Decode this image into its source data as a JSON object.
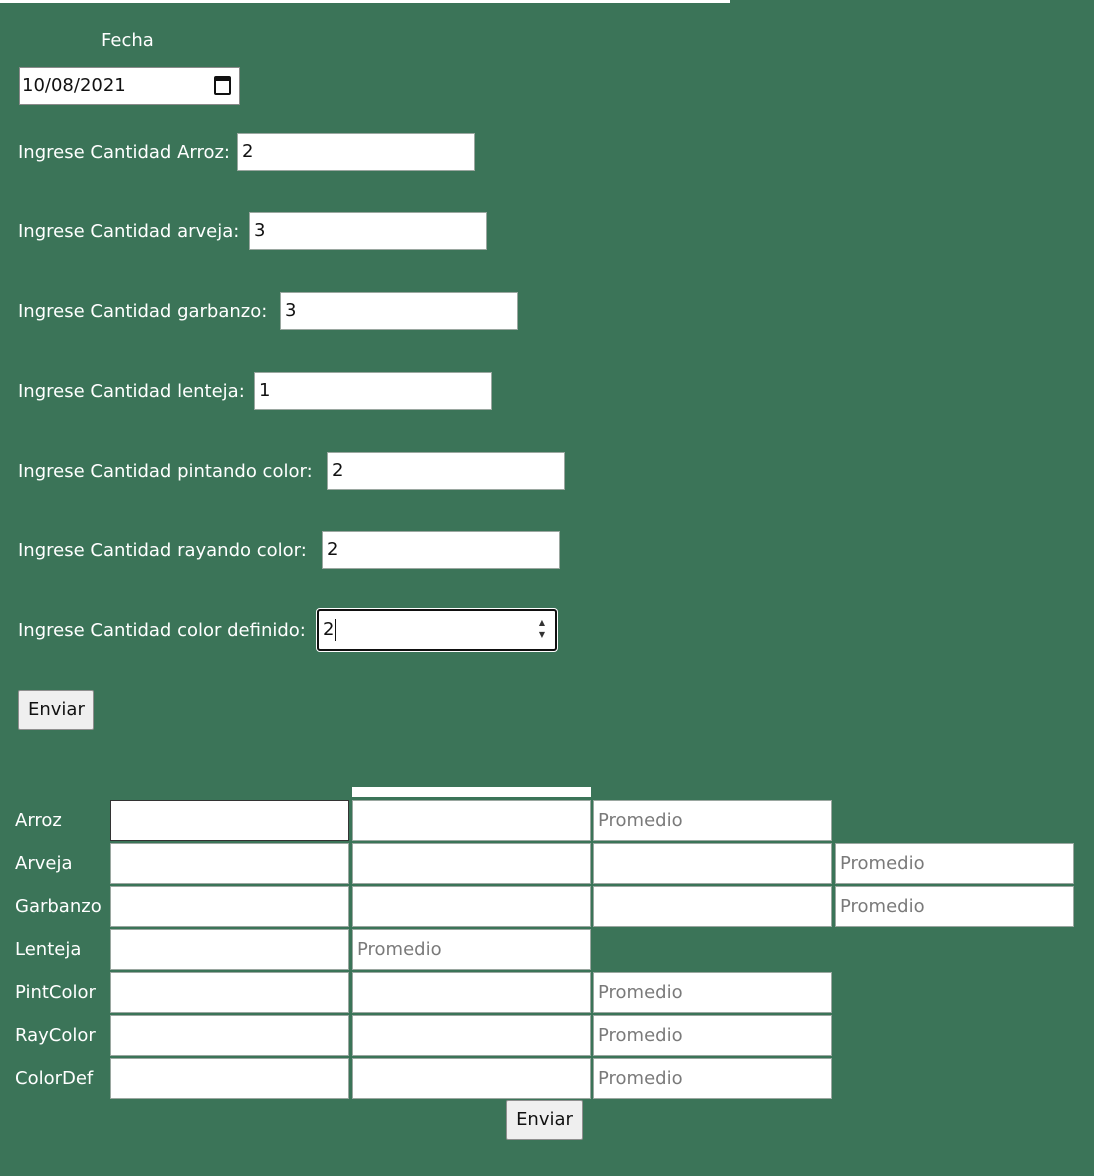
{
  "form": {
    "fecha_label": "Fecha",
    "fecha_value": "10/08/2021",
    "fields": [
      {
        "label": "Ingrese Cantidad Arroz:",
        "value": "2"
      },
      {
        "label": "Ingrese Cantidad arveja:",
        "value": "3"
      },
      {
        "label": "Ingrese Cantidad garbanzo:",
        "value": "3"
      },
      {
        "label": "Ingrese Cantidad lenteja:",
        "value": "1"
      },
      {
        "label": "Ingrese Cantidad pintando color:",
        "value": "2"
      },
      {
        "label": "Ingrese Cantidad rayando color:",
        "value": "2"
      },
      {
        "label": "Ingrese Cantidad color definido:",
        "value": "2"
      }
    ],
    "submit_label": "Enviar"
  },
  "table": {
    "rows": [
      {
        "label": "Arroz",
        "placeholder": "Promedio"
      },
      {
        "label": "Arveja",
        "placeholder": "Promedio"
      },
      {
        "label": "Garbanzo",
        "placeholder": "Promedio"
      },
      {
        "label": "Lenteja",
        "placeholder": "Promedio"
      },
      {
        "label": "PintColor",
        "placeholder": "Promedio"
      },
      {
        "label": "RayColor",
        "placeholder": "Promedio"
      },
      {
        "label": "ColorDef",
        "placeholder": "Promedio"
      }
    ],
    "submit_label": "Enviar"
  },
  "colors": {
    "background": "#3b7458",
    "text": "#ffffff"
  }
}
